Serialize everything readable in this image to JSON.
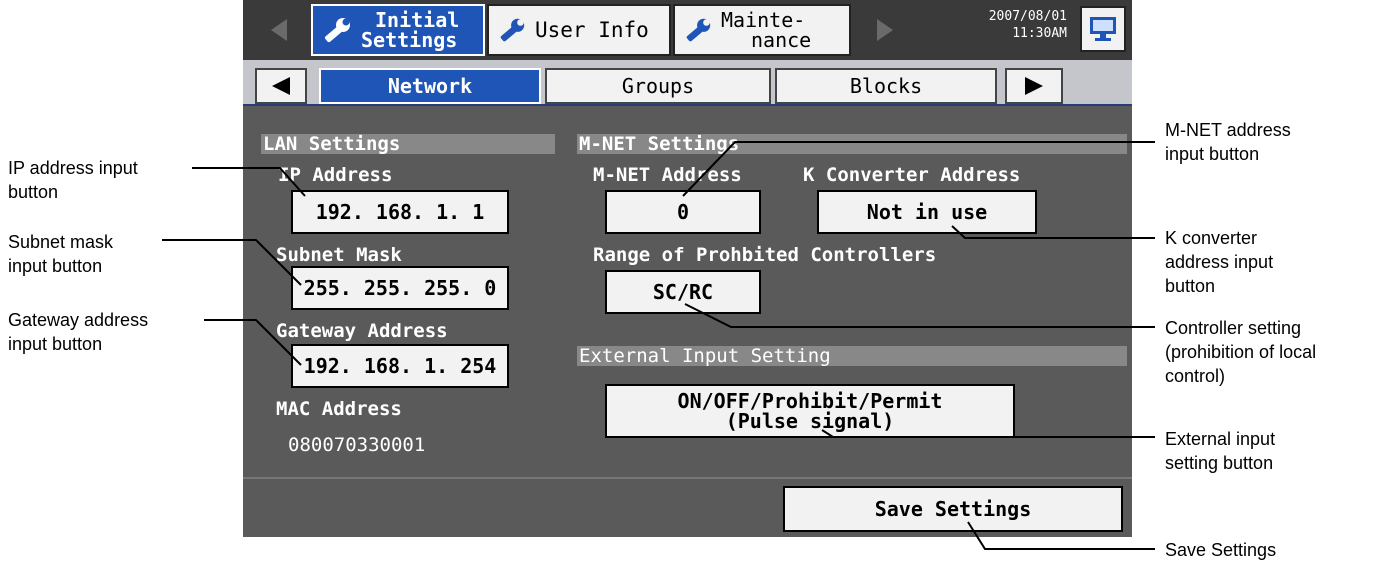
{
  "header": {
    "tabs": [
      {
        "line1": "Initial",
        "line2": "Settings",
        "icon": "wrench-icon",
        "active": true
      },
      {
        "label": "User Info",
        "icon": "wrench-icon",
        "active": false
      },
      {
        "line1": "Mainte-",
        "line2": "nance",
        "icon": "wrench-icon",
        "active": false
      }
    ],
    "date": "2007/08/01",
    "time": "11:30AM",
    "monitor_icon": "monitor-icon"
  },
  "subtabs": [
    "Network",
    "Groups",
    "Blocks"
  ],
  "lan": {
    "title": "LAN Settings",
    "ip_label": "IP Address",
    "ip_value": "192. 168. 1. 1",
    "subnet_label": "Subnet Mask",
    "subnet_value": "255. 255. 255. 0",
    "gateway_label": "Gateway Address",
    "gateway_value": "192. 168. 1. 254",
    "mac_label": "MAC Address",
    "mac_value": "080070330001"
  },
  "mnet": {
    "title": "M-NET Settings",
    "address_label": "M-NET Address",
    "address_value": "0",
    "kconv_label": "K Converter Address",
    "kconv_value": "Not in use",
    "range_label": "Range of Prohbited Controllers",
    "range_value": "SC/RC"
  },
  "external": {
    "title": "External Input Setting",
    "value_line1": "ON/OFF/Prohibit/Permit",
    "value_line2": "(Pulse signal)"
  },
  "save_label": "Save Settings",
  "annotations": {
    "ip": [
      "IP address input",
      "button"
    ],
    "subnet": [
      "Subnet mask",
      "input button"
    ],
    "gateway": [
      "Gateway address",
      "input button"
    ],
    "mnet": [
      "M-NET address",
      "input button"
    ],
    "kconv": [
      "K converter",
      "address input",
      "button"
    ],
    "controller": [
      "Controller setting",
      "(prohibition of local",
      "control)"
    ],
    "external": [
      "External input",
      "setting button"
    ],
    "save": [
      "Save Settings"
    ]
  },
  "colors": {
    "active_tab": "#1f55b7",
    "panel": "#5a5a5a",
    "section_bar": "#888888"
  }
}
